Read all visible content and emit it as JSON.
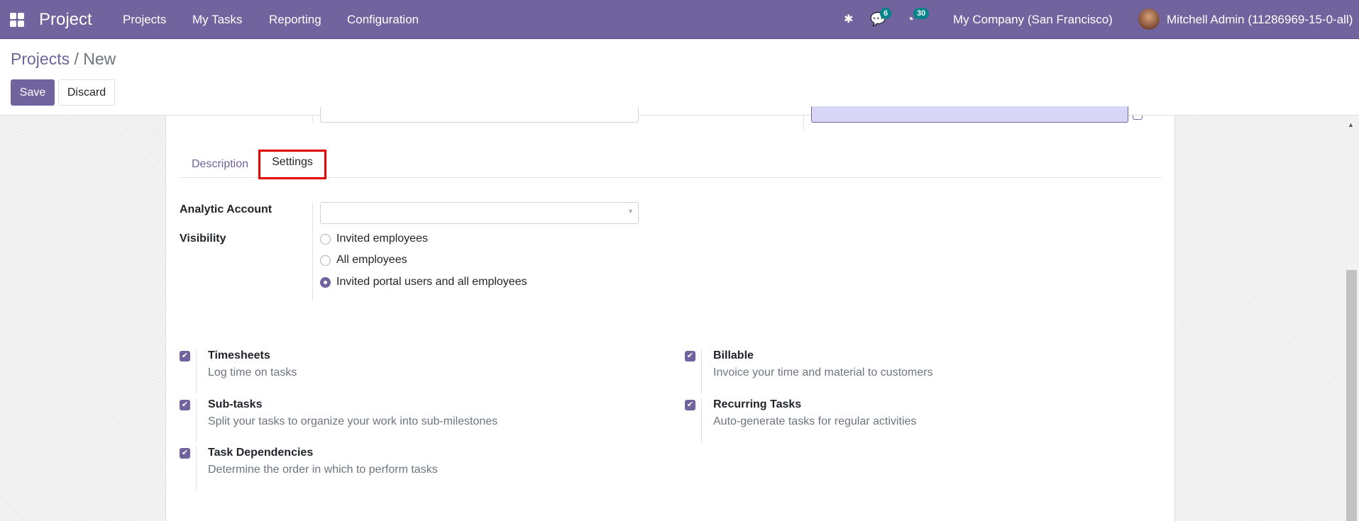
{
  "navbar": {
    "app_title": "Project",
    "menu": [
      "Projects",
      "My Tasks",
      "Reporting",
      "Configuration"
    ],
    "messages_count": "6",
    "activities_count": "30",
    "company": "My Company (San Francisco)",
    "user": "Mitchell Admin (11286969-15-0-all)"
  },
  "breadcrumb": {
    "parent": "Projects",
    "separator": "/",
    "current": "New"
  },
  "buttons": {
    "save": "Save",
    "discard": "Discard"
  },
  "tabs": [
    {
      "label": "Description",
      "active": false
    },
    {
      "label": "Settings",
      "active": true
    }
  ],
  "settings": {
    "analytic_account_label": "Analytic Account",
    "analytic_account_value": "",
    "visibility_label": "Visibility",
    "visibility_options": [
      "Invited employees",
      "All employees",
      "Invited portal users and all employees"
    ],
    "visibility_selected": "Invited portal users and all employees"
  },
  "features": [
    {
      "title": "Timesheets",
      "desc": "Log time on tasks",
      "checked": true
    },
    {
      "title": "Billable",
      "desc": "Invoice your time and material to customers",
      "checked": true
    },
    {
      "title": "Sub-tasks",
      "desc": "Split your tasks to organize your work into sub-milestones",
      "checked": true
    },
    {
      "title": "Recurring Tasks",
      "desc": "Auto-generate tasks for regular activities",
      "checked": true
    },
    {
      "title": "Task Dependencies",
      "desc": "Determine the order in which to perform tasks",
      "checked": true
    }
  ],
  "colors": {
    "brand": "#71639e",
    "badge": "#00838a",
    "highlight": "#e00000"
  }
}
